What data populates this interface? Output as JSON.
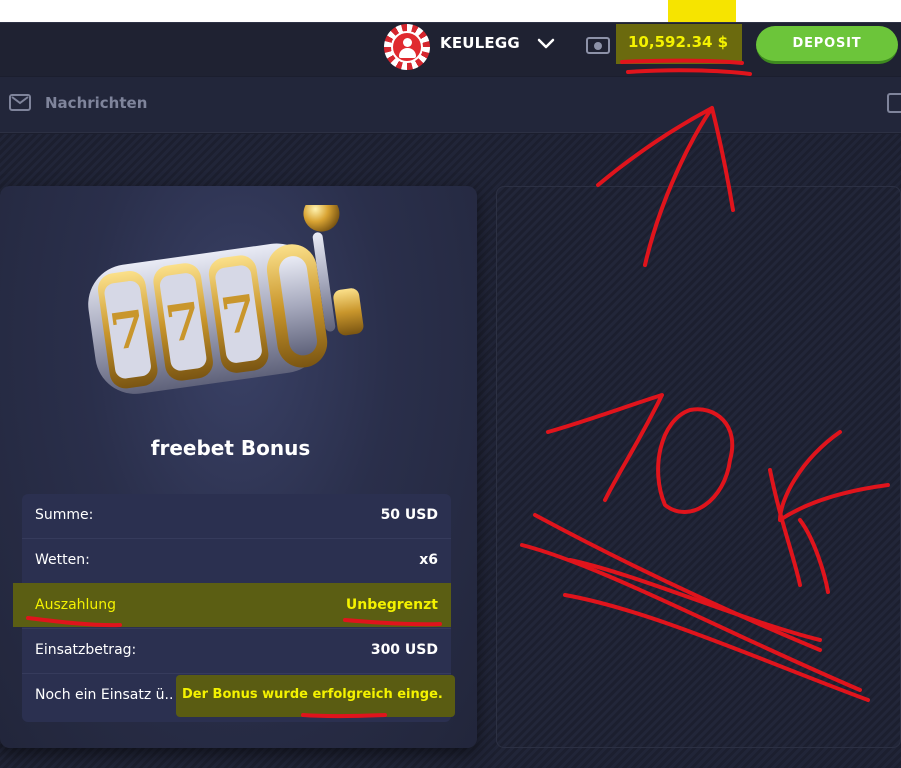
{
  "header": {
    "username": "KEULEGG",
    "balance": "10,592.34 $",
    "deposit_label": "DEPOSIT"
  },
  "subheader": {
    "messages_label": "Nachrichten"
  },
  "bonus_card": {
    "title": "freebet Bonus",
    "rows": [
      {
        "label": "Summe:",
        "value": "50 USD"
      },
      {
        "label": "Wetten:",
        "value": "x6"
      },
      {
        "label": "Auszahlung",
        "value": "Unbegrenzt"
      },
      {
        "label": "Einsatzbetrag:",
        "value": "300 USD"
      },
      {
        "label": "Noch ein Einsatz ü...",
        "value": "Der Bonus wurde erfolgreich einge..."
      }
    ]
  },
  "annotations": {
    "handwritten_text": "10k"
  },
  "colors": {
    "accent_green": "#6cc53a",
    "highlight_yellow": "#f4f200",
    "annotation_red": "#e0141c"
  },
  "icons": {
    "avatar": "user-avatar-icon",
    "chevron": "chevron-down-icon",
    "wallet": "wallet-icon",
    "messages": "mail-icon",
    "exit": "logout-icon",
    "slot_machine": "slot-machine-icon"
  }
}
